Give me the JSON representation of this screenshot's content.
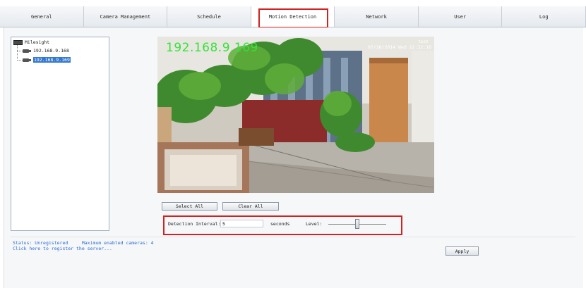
{
  "tabs": [
    {
      "label": "General"
    },
    {
      "label": "Camera Management"
    },
    {
      "label": "Schedule"
    },
    {
      "label": "Motion Detection",
      "active": true
    },
    {
      "label": "Network"
    },
    {
      "label": "User"
    },
    {
      "label": "Log"
    }
  ],
  "tree": {
    "root": {
      "label": "Milesight",
      "icon": "server-icon"
    },
    "cameras": [
      {
        "label": "192.168.9.168",
        "icon": "camera-icon",
        "selected": false
      },
      {
        "label": "192.168.9.169",
        "icon": "camera-icon",
        "selected": true
      }
    ]
  },
  "video": {
    "osd_ip": "192.168.9.169",
    "osd_name": "test",
    "osd_time": "07/16/2014 Wed 22:32:16"
  },
  "buttons": {
    "select_all": "Select All",
    "clear_all": "Clear All",
    "apply": "Apply"
  },
  "detection": {
    "interval_label": "Detection Interval:",
    "interval_value": "5",
    "seconds_label": "seconds",
    "level_label": "Level:",
    "level_fraction": 0.5
  },
  "status": {
    "line1": "Status: Unregistered     Maximum enabled cameras: 4",
    "line2": "Click here to register the server..."
  },
  "colors": {
    "highlight": "#d42020",
    "osd_ip": "#35e23a",
    "selection": "#3478d1",
    "status_text": "#2a6ccf"
  }
}
